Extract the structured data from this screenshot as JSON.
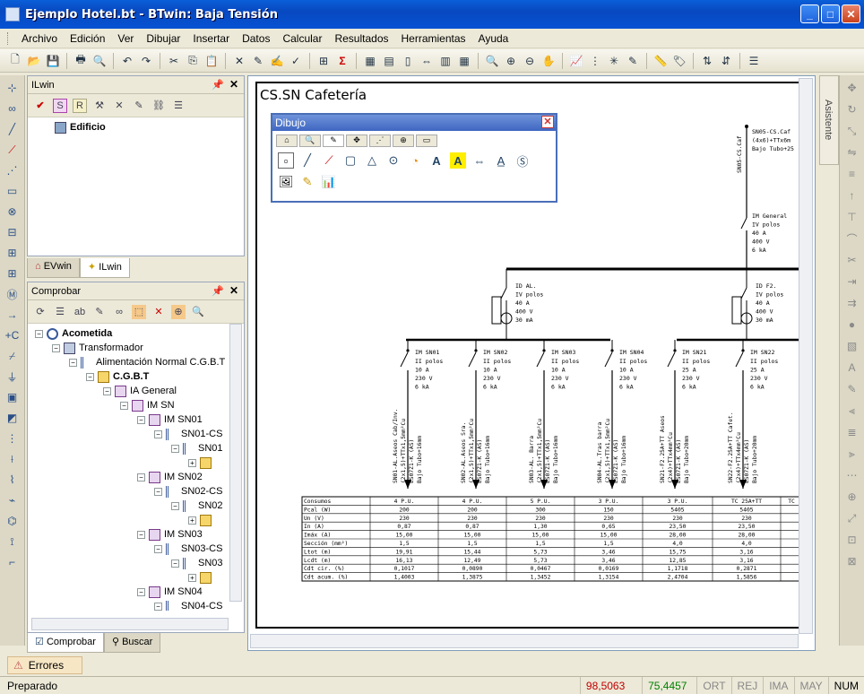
{
  "window": {
    "title": "Ejemplo Hotel.bt - BTwin: Baja Tensión",
    "minimize": "_",
    "maximize": "□",
    "close": "✕"
  },
  "menu": [
    "Archivo",
    "Edición",
    "Ver",
    "Dibujar",
    "Insertar",
    "Datos",
    "Calcular",
    "Resultados",
    "Herramientas",
    "Ayuda"
  ],
  "ilwin": {
    "title": "ILwin",
    "tree_root": "Edificio",
    "tabs": [
      "EVwin",
      "ILwin"
    ]
  },
  "comprobar": {
    "title": "Comprobar",
    "tree": [
      {
        "label": "Acometida",
        "level": 0,
        "bold": true
      },
      {
        "label": "Transformador",
        "level": 1
      },
      {
        "label": "Alimentación Normal C.G.B.T",
        "level": 2
      },
      {
        "label": "C.G.B.T",
        "level": 3,
        "bold": true
      },
      {
        "label": "IA General",
        "level": 4
      },
      {
        "label": "IM SN",
        "level": 5
      },
      {
        "label": "IM SN01",
        "level": 6
      },
      {
        "label": "SN01-CS",
        "level": 7
      },
      {
        "label": "SN01",
        "level": 8
      },
      {
        "label": "",
        "level": 9
      },
      {
        "label": "IM SN02",
        "level": 6
      },
      {
        "label": "SN02-CS",
        "level": 7
      },
      {
        "label": "SN02",
        "level": 8
      },
      {
        "label": "",
        "level": 9
      },
      {
        "label": "IM SN03",
        "level": 6
      },
      {
        "label": "SN03-CS",
        "level": 7
      },
      {
        "label": "SN03",
        "level": 8
      },
      {
        "label": "",
        "level": 9
      },
      {
        "label": "IM SN04",
        "level": 6
      },
      {
        "label": "SN04-CS",
        "level": 7
      }
    ],
    "tabs": [
      "Comprobar",
      "Buscar"
    ]
  },
  "asistente": "Asistente",
  "dibujo": {
    "title": "Dibujo"
  },
  "drawing": {
    "sheet_title": "CS.SN Cafetería",
    "feeder_label": [
      "SN05-CS.Caf",
      "(4x6)+TTx6m",
      "Bajo Tubo+25"
    ],
    "im_general": [
      "IM General",
      "IV polos",
      "40 A",
      "400 V",
      "6 kA"
    ],
    "id_al": [
      "ID AL.",
      "IV polos",
      "40 A",
      "400 V",
      "30 mA"
    ],
    "id_f2": [
      "ID F2.",
      "IV polos",
      "40 A",
      "400 V",
      "30 mA"
    ],
    "breakers": [
      {
        "name": "IM SN01",
        "lines": [
          "II polos",
          "10 A",
          "230 V",
          "6 kA"
        ],
        "cable": [
          "SN01-AL.Aseos Cab/Inv.",
          "(2x1,5)+TTx1,5mm²Cu",
          "ES07Z1-K (AS)",
          "Bajo Tubo+16mm"
        ]
      },
      {
        "name": "IM SN02",
        "lines": [
          "II polos",
          "10 A",
          "230 V",
          "6 kA"
        ],
        "cable": [
          "SN02-AL.Aseos Sra.",
          "(2x1,5)+TTx1,5mm²Cu",
          "ES07Z1-K (AS)",
          "Bajo Tubo+16mm"
        ]
      },
      {
        "name": "IM SN03",
        "lines": [
          "II polos",
          "10 A",
          "230 V",
          "6 kA"
        ],
        "cable": [
          "SN03-AL. Barra",
          "(2x1,5)+TTx1,5mm²Cu",
          "ES07Z1-K (AS)",
          "Bajo Tubo+16mm"
        ]
      },
      {
        "name": "IM SN04",
        "lines": [
          "II polos",
          "10 A",
          "230 V",
          "6 kA"
        ],
        "cable": [
          "SN04-AL.Tras barra",
          "(2x1,5)+TTx1,5mm²Cu",
          "ES07Z1-K (AS)",
          "Bajo Tubo+16mm"
        ]
      },
      {
        "name": "IM SN21",
        "lines": [
          "II polos",
          "25 A",
          "230 V",
          "6 kA"
        ],
        "cable": [
          "SN21-F2.25A+TT Aseos",
          "(2x4)+TTx4mm²Cu",
          "ES07Z1-K (AS)",
          "Bajo Tubo+20mm"
        ]
      },
      {
        "name": "IM SN22",
        "lines": [
          "II polos",
          "25 A",
          "230 V",
          "6 kA"
        ],
        "cable": [
          "SN22-F2.25A+TT Cafet.",
          "(2x4)+TTx4mm²Cu",
          "ES07Z1-K (AS)",
          "Bajo Tubo+20mm"
        ]
      }
    ],
    "table": {
      "rows": [
        [
          "Consumos",
          "4 P.U.",
          "4 P.U.",
          "5 P.U.",
          "3 P.U.",
          "3 P.U.",
          "TC 25A+TT",
          "TC"
        ],
        [
          "Pcal (W)",
          "200",
          "200",
          "300",
          "150",
          "5405",
          "5405",
          ""
        ],
        [
          "Un (V)",
          "230",
          "230",
          "230",
          "230",
          "230",
          "230",
          ""
        ],
        [
          "In (A)",
          "0,87",
          "0,87",
          "1,30",
          "0,65",
          "23,50",
          "23,50",
          ""
        ],
        [
          "Imáx (A)",
          "15,00",
          "15,00",
          "15,00",
          "15,00",
          "28,00",
          "28,00",
          ""
        ],
        [
          "Sección (mm²)",
          "1,5",
          "1,5",
          "1,5",
          "1,5",
          "4,0",
          "4,0",
          ""
        ],
        [
          "Ltot (m)",
          "19,91",
          "15,44",
          "5,73",
          "3,46",
          "15,75",
          "3,16",
          ""
        ],
        [
          "Lcdt (m)",
          "16,13",
          "12,49",
          "5,73",
          "3,46",
          "12,85",
          "3,16",
          ""
        ],
        [
          "Cdt cir. (%)",
          "0,1017",
          "0,0890",
          "0,0467",
          "0,0169",
          "1,1718",
          "0,2871",
          ""
        ],
        [
          "Cdt acum. (%)",
          "1,4003",
          "1,3875",
          "1,3452",
          "1,3154",
          "2,4704",
          "1,5856",
          ""
        ]
      ]
    }
  },
  "errores": "Errores",
  "status": {
    "ready": "Preparado",
    "x": "98,5063",
    "y": "75,4457",
    "ort": "ORT",
    "rej": "REJ",
    "ima": "IMA",
    "may": "MAY",
    "num": "NUM",
    "x_color": "#c00000",
    "y_color": "#008000"
  }
}
